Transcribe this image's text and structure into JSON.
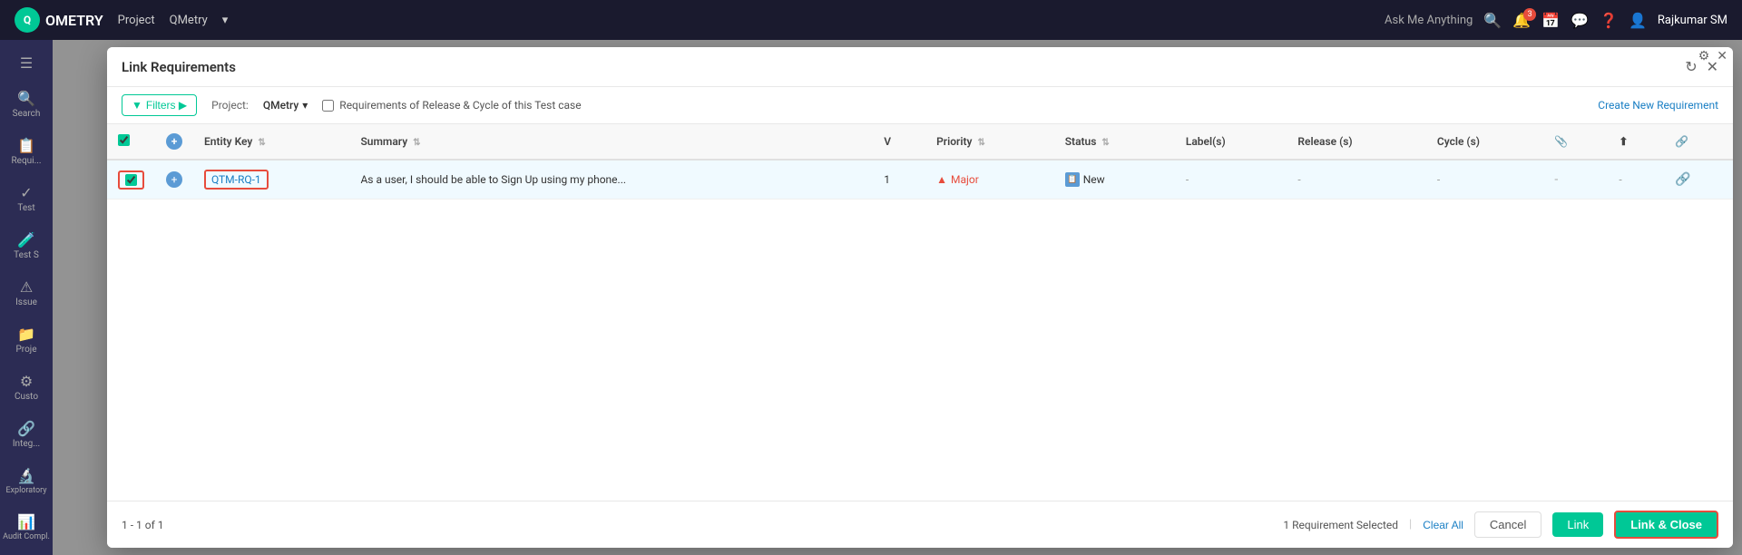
{
  "app": {
    "logo_text": "OMETRY",
    "nav_items": [
      "Project",
      "QMetry"
    ],
    "search_placeholder": "Ask Me Anything",
    "notification_count": "3",
    "user_name": "Rajkumar SM"
  },
  "sidebar": {
    "items": [
      {
        "icon": "☰",
        "label": "Menu"
      },
      {
        "icon": "🔍",
        "label": "Search"
      },
      {
        "icon": "📋",
        "label": "Requi..."
      },
      {
        "icon": "✓",
        "label": "Test"
      },
      {
        "icon": "🧪",
        "label": "Test S"
      },
      {
        "icon": "⚠",
        "label": "Issue"
      },
      {
        "icon": "📁",
        "label": "Proje"
      },
      {
        "icon": "⚙",
        "label": "Custo"
      },
      {
        "icon": "🔗",
        "label": "Integ..."
      },
      {
        "icon": "🔬",
        "label": "Explor..."
      },
      {
        "icon": "📊",
        "label": "Audit..."
      }
    ]
  },
  "modal": {
    "title": "Link Requirements",
    "refresh_label": "↻",
    "close_label": "✕",
    "toolbar": {
      "filter_label": "Filters ▶",
      "project_label": "Project:",
      "project_name": "QMetry",
      "project_dropdown_icon": "▾",
      "checkbox_label": "Requirements of Release & Cycle of this Test case",
      "create_req_label": "Create New Requirement"
    },
    "table": {
      "headers": [
        {
          "key": "checkbox",
          "label": ""
        },
        {
          "key": "add",
          "label": ""
        },
        {
          "key": "entity_key",
          "label": "Entity Key"
        },
        {
          "key": "summary",
          "label": "Summary"
        },
        {
          "key": "v",
          "label": "V"
        },
        {
          "key": "priority",
          "label": "Priority"
        },
        {
          "key": "status",
          "label": "Status"
        },
        {
          "key": "labels",
          "label": "Label(s)"
        },
        {
          "key": "release",
          "label": "Release (s)"
        },
        {
          "key": "cycle",
          "label": "Cycle (s)"
        },
        {
          "key": "attach",
          "label": ""
        },
        {
          "key": "up",
          "label": ""
        },
        {
          "key": "link",
          "label": ""
        }
      ],
      "rows": [
        {
          "checked": true,
          "entity_key": "QTM-RQ-1",
          "summary": "As a user, I should be able to Sign Up using my phone...",
          "v": "1",
          "priority": "Major",
          "priority_level": "major",
          "status": "New",
          "labels": "-",
          "release": "-",
          "cycle": "-",
          "attach": "-",
          "selected": true
        }
      ]
    },
    "footer": {
      "pagination": "1 - 1 of 1",
      "selected_count": "1 Requirement Selected",
      "clear_all_label": "Clear All",
      "cancel_label": "Cancel",
      "link_label": "Link",
      "link_close_label": "Link & Close"
    }
  }
}
